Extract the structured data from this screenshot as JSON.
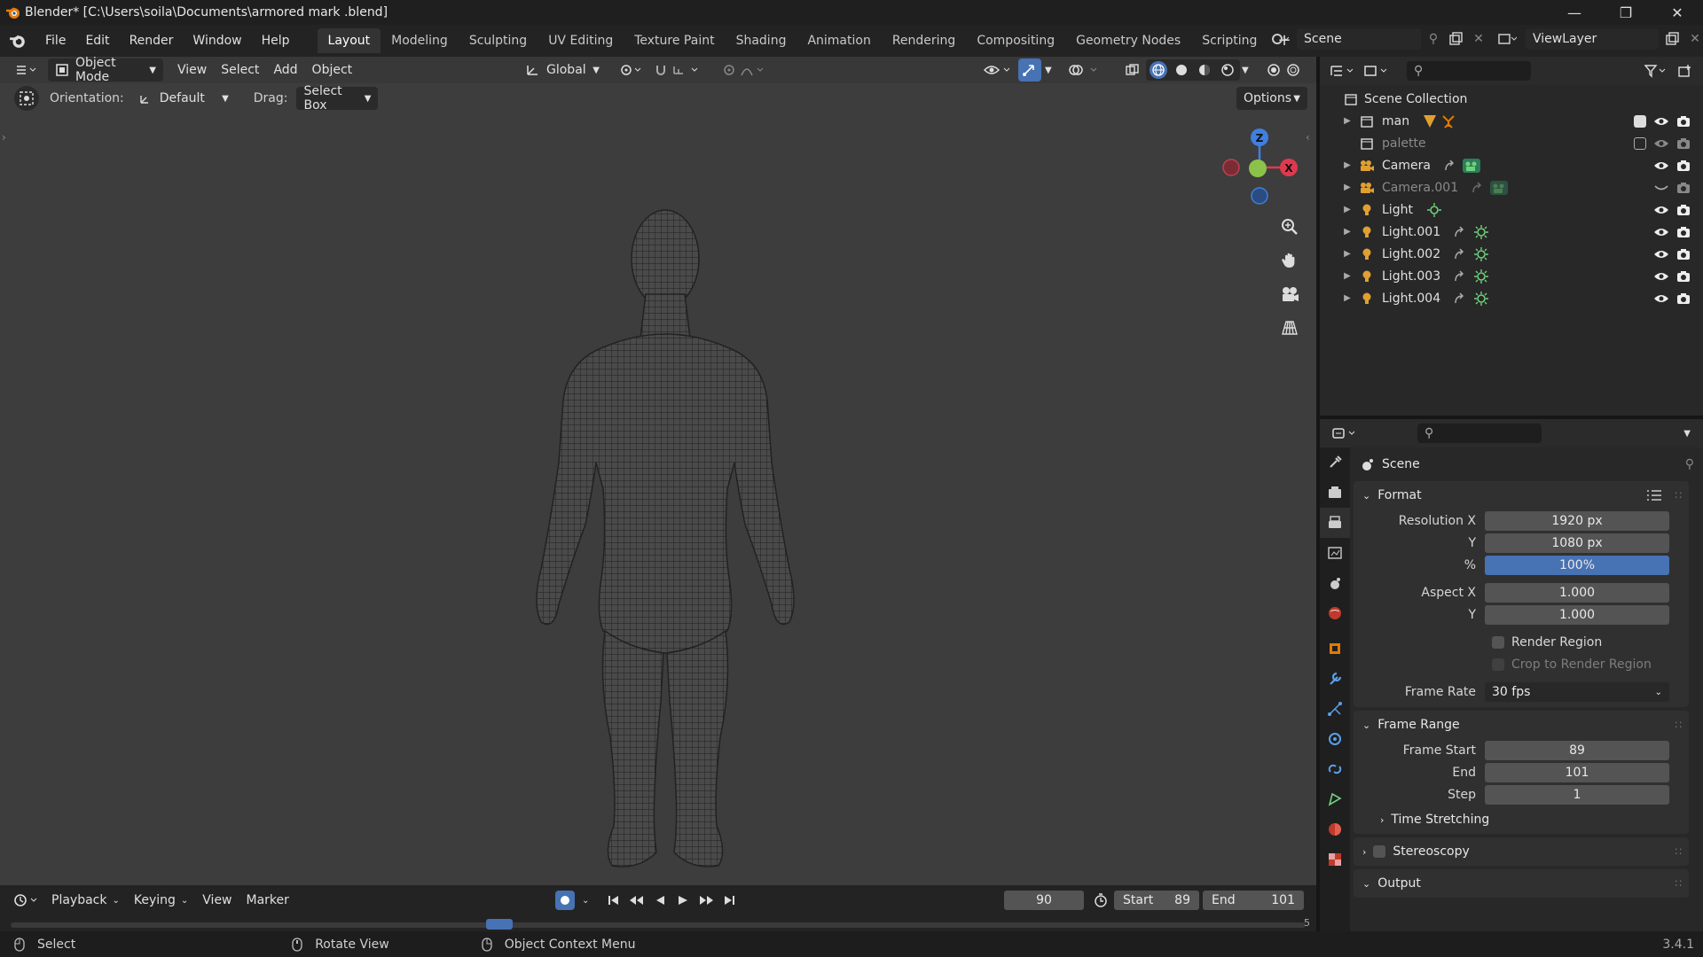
{
  "window": {
    "title": "Blender* [C:\\Users\\soila\\Documents\\armored mark .blend]",
    "controls": [
      "minimize-icon",
      "maximize-icon",
      "close-icon"
    ]
  },
  "menu": [
    "File",
    "Edit",
    "Render",
    "Window",
    "Help"
  ],
  "workspaces": [
    "Layout",
    "Modeling",
    "Sculpting",
    "UV Editing",
    "Texture Paint",
    "Shading",
    "Animation",
    "Rendering",
    "Compositing",
    "Geometry Nodes",
    "Scripting"
  ],
  "active_workspace": "Layout",
  "scene_selector": {
    "scene": "Scene",
    "view_layer": "ViewLayer"
  },
  "viewport_header": {
    "mode": "Object Mode",
    "menus": [
      "View",
      "Select",
      "Add",
      "Object"
    ],
    "transform": "Global"
  },
  "tool_settings": {
    "orientation_label": "Orientation:",
    "orientation_value": "Default",
    "drag_label": "Drag:",
    "drag_value": "Select Box",
    "options": "Options"
  },
  "gizmo": {
    "z": "Z",
    "x": "X"
  },
  "outliner": {
    "collection": "Scene Collection",
    "items": [
      {
        "name": "man",
        "type": "collection",
        "dim": false
      },
      {
        "name": "palette",
        "type": "collection",
        "dim": true
      },
      {
        "name": "Camera",
        "type": "camera",
        "dim": false
      },
      {
        "name": "Camera.001",
        "type": "camera",
        "dim": true
      },
      {
        "name": "Light",
        "type": "light",
        "dim": false
      },
      {
        "name": "Light.001",
        "type": "light",
        "dim": false
      },
      {
        "name": "Light.002",
        "type": "light",
        "dim": false
      },
      {
        "name": "Light.003",
        "type": "light",
        "dim": false
      },
      {
        "name": "Light.004",
        "type": "light",
        "dim": false
      }
    ]
  },
  "properties": {
    "context": "Scene",
    "format": {
      "title": "Format",
      "resolution_x_label": "Resolution X",
      "resolution_x": "1920 px",
      "y_label": "Y",
      "resolution_y": "1080 px",
      "pct_label": "%",
      "percent": "100%",
      "aspect_x_label": "Aspect X",
      "aspect_x": "1.000",
      "aspect_y_label": "Y",
      "aspect_y": "1.000",
      "render_region": "Render Region",
      "crop": "Crop to Render Region",
      "frame_rate_label": "Frame Rate",
      "frame_rate": "30 fps"
    },
    "frame_range": {
      "title": "Frame Range",
      "start_label": "Frame Start",
      "start": "89",
      "end_label": "End",
      "end": "101",
      "step_label": "Step",
      "step": "1"
    },
    "time_stretching": "Time Stretching",
    "stereoscopy": "Stereoscopy",
    "output": "Output"
  },
  "timeline": {
    "menus": [
      "Playback",
      "Keying",
      "View",
      "Marker"
    ],
    "current_frame": "90",
    "start_label": "Start",
    "start": "89",
    "end_label": "End",
    "end": "101",
    "scrub_end": "5"
  },
  "status": {
    "select": "Select",
    "rotate": "Rotate View",
    "context": "Object Context Menu",
    "version": "3.4.1"
  },
  "colors": {
    "accent": "#4772b3",
    "gizmo_x": "#e0394e",
    "gizmo_y": "#8bc34a",
    "gizmo_z": "#3f7fe0",
    "light_icon": "#e0a030",
    "data_green": "#6fd27b"
  }
}
